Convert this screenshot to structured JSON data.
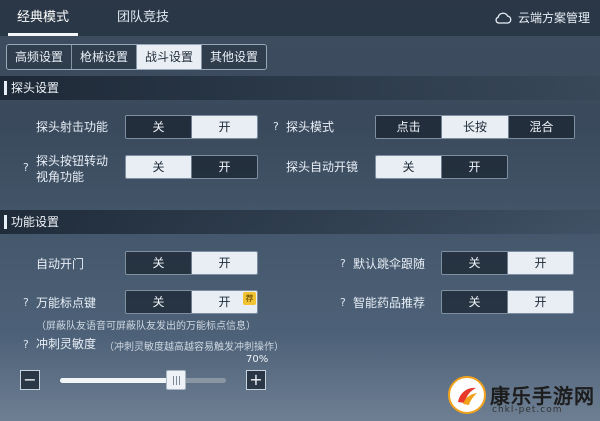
{
  "top_tabs": [
    {
      "label": "经典模式",
      "active": true
    },
    {
      "label": "团队竞技",
      "active": false
    }
  ],
  "cloud_label": "云端方案管理",
  "sub_tabs": [
    {
      "label": "高频设置",
      "active": false
    },
    {
      "label": "枪械设置",
      "active": false
    },
    {
      "label": "战斗设置",
      "active": true
    },
    {
      "label": "其他设置",
      "active": false
    }
  ],
  "sections": {
    "peek": {
      "title": "探头设置",
      "peek_fire": {
        "label": "探头射击功能",
        "options": [
          "关",
          "开"
        ],
        "selected": 1
      },
      "peek_mode": {
        "help": "?",
        "label": "探头模式",
        "options": [
          "点击",
          "长按",
          "混合"
        ],
        "selected": 1
      },
      "peek_rotate": {
        "help": "?",
        "label_line1": "探头按钮转动",
        "label_line2": "视角功能",
        "options": [
          "关",
          "开"
        ],
        "selected": 0
      },
      "peek_scope": {
        "label": "探头自动开镜",
        "options": [
          "关",
          "开"
        ],
        "selected": 0
      }
    },
    "function": {
      "title": "功能设置",
      "auto_door": {
        "label": "自动开门",
        "options": [
          "关",
          "开"
        ],
        "selected": 1
      },
      "parachute_follow": {
        "help": "?",
        "label": "默认跳伞跟随",
        "options": [
          "关",
          "开"
        ],
        "selected": 1
      },
      "marker_key": {
        "help": "?",
        "label": "万能标点键",
        "options": [
          "关",
          "开"
        ],
        "selected": 1,
        "badge": "荐",
        "note": "（屏蔽队友语音可屏蔽队友发出的万能标点信息）"
      },
      "smart_medicine": {
        "help": "?",
        "label": "智能药品推荐",
        "options": [
          "关",
          "开"
        ],
        "selected": 1
      },
      "sprint": {
        "help": "?",
        "label": "冲刺灵敏度",
        "note": "（冲刺灵敏度越高越容易触发冲刺操作）",
        "value_text": "70%",
        "value": 0.7,
        "minus": "−",
        "plus": "+"
      }
    }
  },
  "watermark": {
    "title": "康乐手游网",
    "url": "chkl-pet.com"
  }
}
